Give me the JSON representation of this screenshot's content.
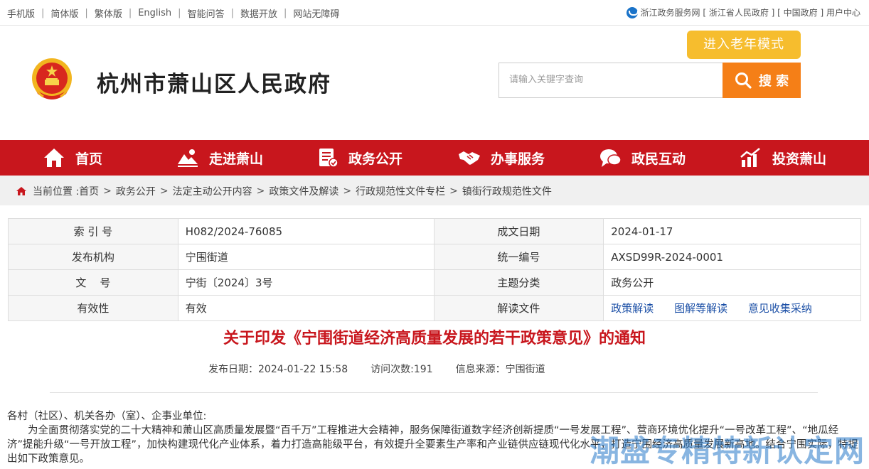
{
  "topbar": {
    "links": [
      "手机版",
      "简体版",
      "繁体版",
      "English",
      "智能问答",
      "数据开放",
      "网站无障碍"
    ],
    "right_prefix": "浙江政务服务网",
    "right_links": [
      "浙江省人民政府",
      "中国政府"
    ],
    "user_center": "用户中心"
  },
  "header": {
    "site_title": "杭州市萧山区人民政府",
    "elder_mode": "进入老年模式",
    "search_placeholder": "请输入关键字查询",
    "search_button": "搜 索"
  },
  "nav": {
    "items": [
      {
        "label": "首页",
        "icon": "home-icon"
      },
      {
        "label": "走进萧山",
        "icon": "landscape-icon"
      },
      {
        "label": "政务公开",
        "icon": "document-icon"
      },
      {
        "label": "办事服务",
        "icon": "handshake-icon"
      },
      {
        "label": "政民互动",
        "icon": "chat-icon"
      },
      {
        "label": "投资萧山",
        "icon": "chart-icon"
      }
    ]
  },
  "breadcrumb": {
    "prefix": "当前位置 :",
    "items": [
      "首页",
      "政务公开",
      "法定主动公开内容",
      "政策文件及解读",
      "行政规范性文件专栏",
      "镇街行政规范性文件"
    ]
  },
  "info": {
    "rows": [
      {
        "k1": "索 引 号",
        "v1": "H082/2024-76085",
        "k2": "成文日期",
        "v2": "2024-01-17"
      },
      {
        "k1": "发布机构",
        "v1": "宁围街道",
        "k2": "统一编号",
        "v2": "AXSD99R-2024-0001"
      },
      {
        "k1": "文    号",
        "v1": "宁街〔2024〕3号",
        "k2": "主题分类",
        "v2": "政务公开"
      },
      {
        "k1": "有效性",
        "v1": "有效",
        "k2": "解读文件"
      }
    ],
    "interpret_links": [
      "政策解读",
      "图解等解读",
      "意见收集采纳"
    ]
  },
  "article": {
    "title": "关于印发《宁围街道经济高质量发展的若干政策意见》的通知",
    "publish_date": "发布日期：2024-01-22 15:58",
    "visits": "访问次数:191",
    "source": "信息来源：宁围街道",
    "salutation": "各村（社区）、机关各办（室）、企事业单位:",
    "paragraph": "为全面贯彻落实党的二十大精神和萧山区高质量发展暨“百千万”工程推进大会精神，服务保障街道数字经济创新提质“一号发展工程”、营商环境优化提升“一号改革工程”、“地瓜经济”提能升级“一号开放工程”，加快构建现代化产业体系，着力打造高能级平台，有效提升全要素生产率和产业链供应链现代化水平，打造宁围经济高质量发展新高地。结合宁围实际，特提出如下政策意见。"
  },
  "watermark": "潮盛专精特新认定网",
  "colors": {
    "nav_red": "#c8161d",
    "search_orange": "#f57f17",
    "elder_yellow": "#f6bd2e",
    "link_blue": "#1b4fa6"
  }
}
